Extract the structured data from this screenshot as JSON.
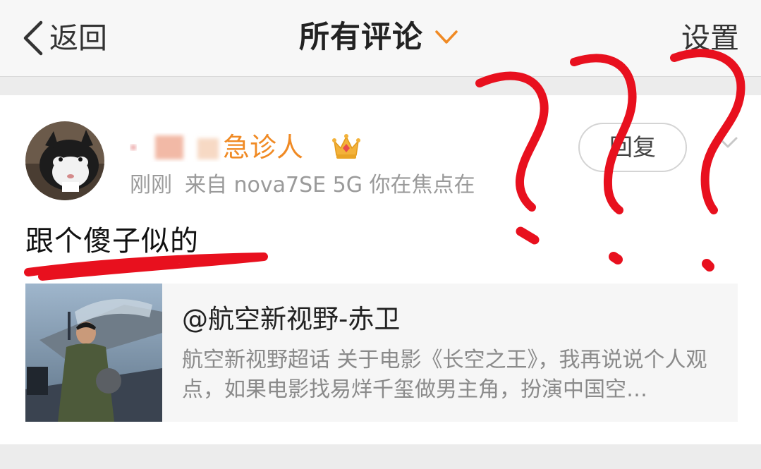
{
  "nav": {
    "back_label": "返回",
    "title": "所有评论",
    "settings_label": "设置"
  },
  "comment": {
    "username": "急诊人",
    "time": "刚刚",
    "source": "来自 nova7SE 5G 你在焦点在",
    "text": "跟个傻子似的",
    "reply_label": "回复",
    "badge_icon": "crown-icon"
  },
  "shared_post": {
    "author": "@航空新视野-赤卫",
    "excerpt": "航空新视野超话 关于电影《长空之王》，我再说说个人观点，如果电影找易烊千玺做男主角，扮演中国空…"
  },
  "icons": {
    "back": "chevron-left-icon",
    "title_dropdown": "chevron-down-icon",
    "more": "chevron-down-icon"
  },
  "colors": {
    "accent_orange": "#f08a24",
    "annotation_red": "#e8101e",
    "nav_background": "#f7f7f7",
    "separator": "#ececec"
  }
}
